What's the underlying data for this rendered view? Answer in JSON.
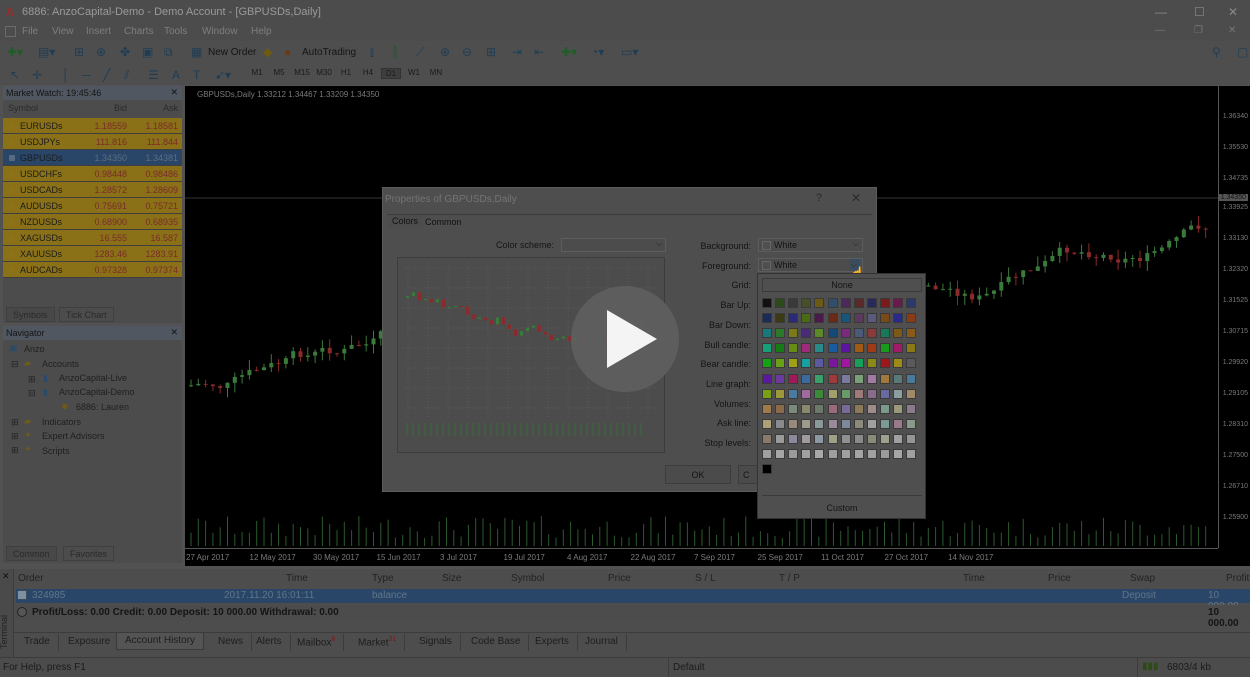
{
  "window": {
    "title": "6886: AnzoCapital-Demo - Demo Account - [GBPUSDs,Daily]",
    "controls": [
      "—",
      "☐",
      "✕"
    ]
  },
  "menu": [
    "File",
    "View",
    "Insert",
    "Charts",
    "Tools",
    "Window",
    "Help"
  ],
  "toolbar": {
    "new_order": "New Order",
    "autotrading": "AutoTrading",
    "timeframes": [
      "M1",
      "M5",
      "M15",
      "M30",
      "H1",
      "H4",
      "D1",
      "W1",
      "MN"
    ],
    "active_timeframe": "D1"
  },
  "market_watch": {
    "title": "Market Watch: 19:45:46",
    "columns": [
      "Symbol",
      "Bid",
      "Ask"
    ],
    "rows": [
      {
        "symbol": "EURUSDs",
        "bid": "1.18559",
        "ask": "1.18581",
        "color": "#8a7118"
      },
      {
        "symbol": "USDJPYs",
        "bid": "111.816",
        "ask": "111.844",
        "color": "#8a7118"
      },
      {
        "symbol": "GBPUSDs",
        "bid": "1.34350",
        "ask": "1.34381",
        "color": "#294669",
        "selected": true
      },
      {
        "symbol": "USDCHFs",
        "bid": "0.98448",
        "ask": "0.98486",
        "color": "#8a7118"
      },
      {
        "symbol": "USDCADs",
        "bid": "1.28572",
        "ask": "1.28609",
        "color": "#8a7118"
      },
      {
        "symbol": "AUDUSDs",
        "bid": "0.75691",
        "ask": "0.75721",
        "color": "#8a7118"
      },
      {
        "symbol": "NZDUSDs",
        "bid": "0.68900",
        "ask": "0.68935",
        "color": "#8a7118"
      },
      {
        "symbol": "XAGUSDs",
        "bid": "16.555",
        "ask": "16.587",
        "color": "#8a7118"
      },
      {
        "symbol": "XAUUSDs",
        "bid": "1283.46",
        "ask": "1283.91",
        "color": "#8a7118"
      },
      {
        "symbol": "AUDCADs",
        "bid": "0.97328",
        "ask": "0.97374",
        "color": "#8a7118"
      }
    ],
    "tabs": [
      "Symbols",
      "Tick Chart"
    ]
  },
  "navigator": {
    "title": "Navigator",
    "items": [
      "Anzo",
      "Accounts",
      "AnzoCapital-Live",
      "AnzoCapital-Demo",
      "6886: Lauren",
      "Indicators",
      "Expert Advisors",
      "Scripts"
    ],
    "tabs": [
      "Common",
      "Favorites"
    ]
  },
  "chart": {
    "header": "GBPUSDs,Daily  1.33212 1.34467 1.33209 1.34350",
    "price_labels": [
      "1.36340",
      "1.35530",
      "1.34735",
      "1.34350",
      "1.33925",
      "1.33130",
      "1.32320",
      "1.31525",
      "1.30715",
      "1.29920",
      "1.29105",
      "1.28310",
      "1.27500",
      "1.26710",
      "1.25900"
    ],
    "current_price": "1.34350",
    "date_labels": [
      "27 Apr 2017",
      "12 May 2017",
      "30 May 2017",
      "15 Jun 2017",
      "3 Jul 2017",
      "19 Jul 2017",
      "4 Aug 2017",
      "22 Aug 2017",
      "7 Sep 2017",
      "25 Sep 2017",
      "11 Oct 2017",
      "27 Oct 2017",
      "14 Nov 2017"
    ]
  },
  "dialog": {
    "title": "Properties of GBPUSDs,Daily",
    "help": "?",
    "close": "✕",
    "tabs": [
      "Colors",
      "Common"
    ],
    "color_scheme_label": "Color scheme:",
    "color_scheme_value": "",
    "labels": [
      "Background:",
      "Foreground:",
      "Grid:",
      "Bar Up:",
      "Bar Down:",
      "Bull candle:",
      "Bear candle:",
      "Line graph:",
      "Volumes:",
      "Ask line:",
      "Stop levels:"
    ],
    "background_value": "White",
    "foreground_value": "White",
    "ok": "OK",
    "cancel_partial": "C"
  },
  "palette": {
    "none_label": "None",
    "custom_label": "Custom"
  },
  "terminal": {
    "side_label": "Terminal",
    "columns": [
      "Order",
      "Time",
      "Type",
      "Size",
      "Symbol",
      "Price",
      "S / L",
      "T / P",
      "Time",
      "Price",
      "Swap",
      "Profit"
    ],
    "row": {
      "order": "324985",
      "time": "2017.11.20 16:01:11",
      "type": "balance",
      "swap": "Deposit",
      "profit": "10 000.00"
    },
    "summary": "Profit/Loss: 0.00  Credit: 0.00  Deposit: 10 000.00  Withdrawal: 0.00",
    "summary_value": "10 000.00",
    "tabs": [
      "Trade",
      "Exposure",
      "Account History",
      "News",
      "Alerts",
      "Mailbox",
      "Market",
      "Signals",
      "Code Base",
      "Experts",
      "Journal"
    ],
    "mailbox_badge": "6",
    "market_badge": "31",
    "active_tab": "Account History"
  },
  "status": {
    "help": "For Help, press F1",
    "profile": "Default",
    "traffic": "6803/4 kb"
  }
}
